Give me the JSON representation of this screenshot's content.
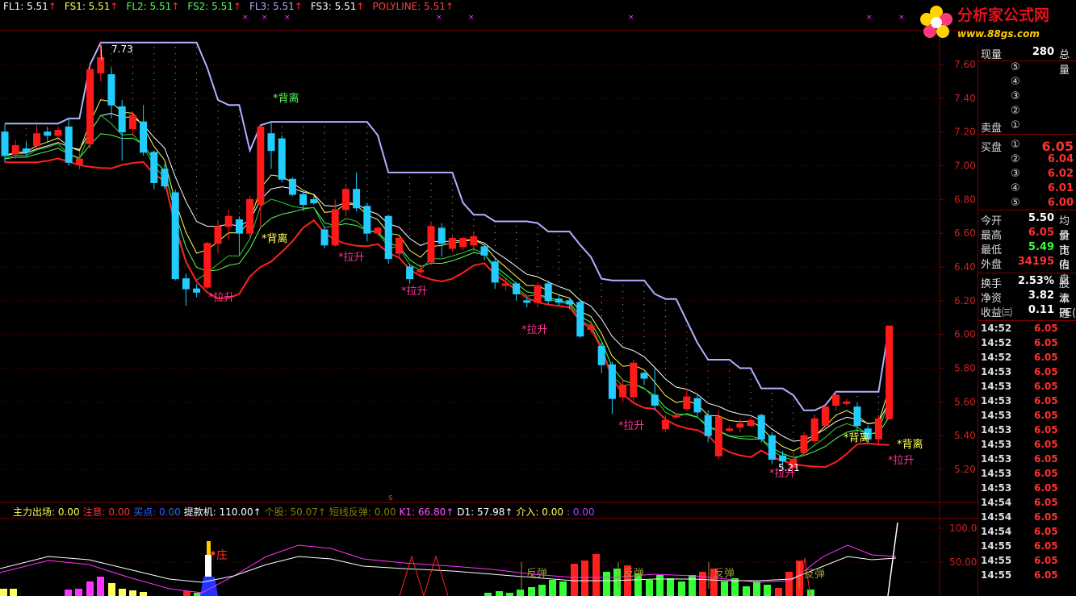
{
  "topbar": [
    {
      "text": "FL1: 5.51",
      "color": "#ffffff"
    },
    {
      "text": "FS1: 5.51",
      "color": "#ffff55"
    },
    {
      "text": "FL2: 5.51",
      "color": "#55ff55"
    },
    {
      "text": "FS2: 5.51",
      "color": "#55ff55"
    },
    {
      "text": "FL3: 5.51",
      "color": "#b0b0ff"
    },
    {
      "text": "FS3: 5.51",
      "color": "#ffffff"
    },
    {
      "text": "POLYLINE: 5.51",
      "color": "#ff4040"
    }
  ],
  "logo": {
    "text": "分析家公式网",
    "url": "www.88gs.com"
  },
  "y_axis": {
    "labels": [
      "7.60",
      "7.40",
      "7.20",
      "7.00",
      "6.80",
      "6.60",
      "6.40",
      "6.20",
      "6.00",
      "5.80",
      "5.60",
      "5.40",
      "5.20"
    ],
    "sub_labels": [
      "100.0",
      "50.00"
    ]
  },
  "annotations": {
    "high_price": "7.73",
    "low_price": "5.21",
    "beili": "*背离",
    "lasheng": "*拉升",
    "s_marker": "s",
    "zhuang": "庄",
    "fantan": "反弹"
  },
  "subbar": [
    {
      "text": "主力出场: 0.00",
      "color": "#ffff55"
    },
    {
      "text": "注意: 0.00",
      "color": "#ff3030"
    },
    {
      "text": "买点: 0.00",
      "color": "#3060ff"
    },
    {
      "text": "提款机: 110.00↑",
      "color": "#ffffff"
    },
    {
      "text": "个股: 50.07↑",
      "color": "#808000"
    },
    {
      "text": "短线反弹: 0.00",
      "color": "#808000"
    },
    {
      "text": "K1: 66.80↑",
      "color": "#ff55ff"
    },
    {
      "text": "D1: 57.98↑",
      "color": "#ffffff"
    },
    {
      "text": "介入: 0.00",
      "color": "#ffff55"
    },
    {
      "text": ": 0.00",
      "color": "#b040ff"
    }
  ],
  "panel": {
    "top": [
      {
        "k": "现量",
        "v": "280",
        "cut": "总量"
      }
    ],
    "sell": [
      "⑤",
      "④",
      "③",
      "②",
      "①"
    ],
    "sell_label": "卖盘",
    "buy_label": "买盘",
    "buy": [
      {
        "n": "①",
        "v": "6.05"
      },
      {
        "n": "②",
        "v": "6.04"
      },
      {
        "n": "③",
        "v": "6.02"
      },
      {
        "n": "④",
        "v": "6.01"
      },
      {
        "n": "⑤",
        "v": "6.00"
      }
    ],
    "stats1": [
      {
        "k": "今开",
        "v": "5.50",
        "c": "#ffffff",
        "cut": "均价"
      },
      {
        "k": "最高",
        "v": "6.05",
        "c": "#ff3030",
        "cut": "量比"
      },
      {
        "k": "最低",
        "v": "5.49",
        "c": "#33ff33",
        "cut": "市值"
      },
      {
        "k": "外盘",
        "v": "34195",
        "c": "#ff3030",
        "cut": "内盘"
      }
    ],
    "stats2": [
      {
        "k": "换手",
        "v": "2.53%",
        "c": "#ffffff",
        "cut": "股本"
      },
      {
        "k": "净资",
        "v": "3.82",
        "c": "#ffffff",
        "cut": "流通"
      },
      {
        "k": "收益㈢",
        "v": "0.11",
        "c": "#ffffff",
        "cut": "PE(动)"
      }
    ],
    "ticks": [
      {
        "t": "14:52",
        "p": "6.05"
      },
      {
        "t": "14:52",
        "p": "6.05"
      },
      {
        "t": "14:52",
        "p": "6.05"
      },
      {
        "t": "14:53",
        "p": "6.05"
      },
      {
        "t": "14:53",
        "p": "6.05"
      },
      {
        "t": "14:53",
        "p": "6.05"
      },
      {
        "t": "14:53",
        "p": "6.05"
      },
      {
        "t": "14:53",
        "p": "6.05"
      },
      {
        "t": "14:53",
        "p": "6.05"
      },
      {
        "t": "14:53",
        "p": "6.05"
      },
      {
        "t": "14:53",
        "p": "6.05"
      },
      {
        "t": "14:53",
        "p": "6.05"
      },
      {
        "t": "14:54",
        "p": "6.05"
      },
      {
        "t": "14:54",
        "p": "6.05"
      },
      {
        "t": "14:54",
        "p": "6.05"
      },
      {
        "t": "14:55",
        "p": "6.05"
      },
      {
        "t": "14:55",
        "p": "6.05"
      },
      {
        "t": "14:55",
        "p": "6.05"
      }
    ]
  },
  "colors": {
    "up": "#ff1a1a",
    "down": "#22ccff",
    "grid": "#7a0000"
  },
  "chart_data": {
    "type": "candlestick",
    "ylim": [
      5.1,
      7.8
    ],
    "candles": [
      [
        7.2,
        7.06,
        7.25,
        7.02
      ],
      [
        7.07,
        7.12,
        7.15,
        7.04
      ],
      [
        7.1,
        7.08,
        7.14,
        7.06
      ],
      [
        7.12,
        7.19,
        7.24,
        7.1
      ],
      [
        7.2,
        7.18,
        7.23,
        7.14
      ],
      [
        7.18,
        7.21,
        7.23,
        7.15
      ],
      [
        7.23,
        7.02,
        7.28,
        7.0
      ],
      [
        7.01,
        7.04,
        7.08,
        6.98
      ],
      [
        7.13,
        7.57,
        7.6,
        7.1
      ],
      [
        7.55,
        7.64,
        7.73,
        7.5
      ],
      [
        7.54,
        7.36,
        7.58,
        7.28
      ],
      [
        7.35,
        7.2,
        7.39,
        7.03
      ],
      [
        7.22,
        7.3,
        7.32,
        7.18
      ],
      [
        7.26,
        7.08,
        7.36,
        7.06
      ],
      [
        7.08,
        6.9,
        7.09,
        6.86
      ],
      [
        6.98,
        6.88,
        7.01,
        6.86
      ],
      [
        6.84,
        6.33,
        6.86,
        6.32
      ],
      [
        6.33,
        6.27,
        6.36,
        6.17
      ],
      [
        6.27,
        6.25,
        6.3,
        6.22
      ],
      [
        6.28,
        6.54,
        6.55,
        6.27
      ],
      [
        6.54,
        6.64,
        6.67,
        6.48
      ],
      [
        6.64,
        6.7,
        6.74,
        6.56
      ],
      [
        6.68,
        6.6,
        6.7,
        6.47
      ],
      [
        6.6,
        6.8,
        6.82,
        6.56
      ],
      [
        6.77,
        7.23,
        7.24,
        6.63
      ],
      [
        7.19,
        7.09,
        7.26,
        6.98
      ],
      [
        7.16,
        6.92,
        7.18,
        6.9
      ],
      [
        6.92,
        6.83,
        6.93,
        6.82
      ],
      [
        6.83,
        6.77,
        6.85,
        6.73
      ],
      [
        6.8,
        6.78,
        6.82,
        6.77
      ],
      [
        6.62,
        6.53,
        6.64,
        6.51
      ],
      [
        6.53,
        6.74,
        6.8,
        6.52
      ],
      [
        6.74,
        6.86,
        6.88,
        6.7
      ],
      [
        6.86,
        6.75,
        6.96,
        6.73
      ],
      [
        6.76,
        6.6,
        6.78,
        6.55
      ],
      [
        6.6,
        6.63,
        6.64,
        6.58
      ],
      [
        6.7,
        6.45,
        6.71,
        6.42
      ],
      [
        6.48,
        6.57,
        6.58,
        6.45
      ],
      [
        6.4,
        6.33,
        6.42,
        6.3
      ],
      [
        6.38,
        6.38,
        6.42,
        6.35
      ],
      [
        6.43,
        6.64,
        6.67,
        6.41
      ],
      [
        6.63,
        6.54,
        6.66,
        6.46
      ],
      [
        6.51,
        6.57,
        6.58,
        6.49
      ],
      [
        6.52,
        6.57,
        6.58,
        6.5
      ],
      [
        6.53,
        6.58,
        6.61,
        6.49
      ],
      [
        6.52,
        6.47,
        6.53,
        6.44
      ],
      [
        6.43,
        6.31,
        6.46,
        6.27
      ],
      [
        6.29,
        6.3,
        6.33,
        6.26
      ],
      [
        6.3,
        6.24,
        6.31,
        6.2
      ],
      [
        6.2,
        6.19,
        6.22,
        6.16
      ],
      [
        6.19,
        6.29,
        6.31,
        6.16
      ],
      [
        6.3,
        6.2,
        6.32,
        6.18
      ],
      [
        6.21,
        6.19,
        6.24,
        6.17
      ],
      [
        6.2,
        6.18,
        6.21,
        6.15
      ],
      [
        6.19,
        5.99,
        6.21,
        5.98
      ],
      [
        6.03,
        6.05,
        6.08,
        6.01
      ],
      [
        5.93,
        5.82,
        5.95,
        5.77
      ],
      [
        5.82,
        5.62,
        5.84,
        5.53
      ],
      [
        5.63,
        5.7,
        5.73,
        5.6
      ],
      [
        5.63,
        5.83,
        5.85,
        5.6
      ],
      [
        5.77,
        5.74,
        5.78,
        5.7
      ],
      [
        5.64,
        5.58,
        5.8,
        5.55
      ],
      [
        5.44,
        5.49,
        5.52,
        5.42
      ],
      [
        5.51,
        5.52,
        5.53,
        5.5
      ],
      [
        5.56,
        5.63,
        5.68,
        5.55
      ],
      [
        5.62,
        5.54,
        5.64,
        5.51
      ],
      [
        5.52,
        5.4,
        5.55,
        5.36
      ],
      [
        5.28,
        5.51,
        5.55,
        5.26
      ],
      [
        5.44,
        5.44,
        5.46,
        5.42
      ],
      [
        5.45,
        5.47,
        5.5,
        5.42
      ],
      [
        5.46,
        5.49,
        5.51,
        5.45
      ],
      [
        5.52,
        5.38,
        5.53,
        5.36
      ],
      [
        5.4,
        5.26,
        5.42,
        5.23
      ],
      [
        5.28,
        5.25,
        5.31,
        5.22
      ],
      [
        5.21,
        5.26,
        5.32,
        5.21
      ],
      [
        5.3,
        5.4,
        5.42,
        5.28
      ],
      [
        5.37,
        5.5,
        5.52,
        5.35
      ],
      [
        5.46,
        5.57,
        5.58,
        5.43
      ],
      [
        5.58,
        5.64,
        5.66,
        5.56
      ],
      [
        5.6,
        5.6,
        5.62,
        5.58
      ],
      [
        5.57,
        5.46,
        5.59,
        5.42
      ],
      [
        5.44,
        5.38,
        5.46,
        5.36
      ],
      [
        5.38,
        5.5,
        5.52,
        5.34
      ],
      [
        5.5,
        6.05,
        6.05,
        5.49
      ]
    ]
  }
}
